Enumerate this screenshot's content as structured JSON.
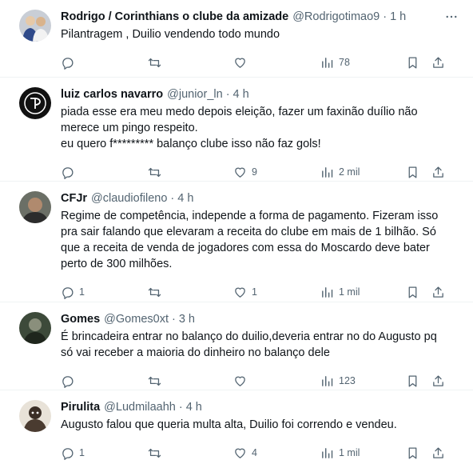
{
  "tweets": [
    {
      "name": "Rodrigo / Corinthians o clube da amizade",
      "handle": "@Rodrigotimao9",
      "sep": "·",
      "time": "1 h",
      "lines": [
        "Pilantragem , Duilio vendendo todo mundo"
      ],
      "replies": "",
      "retweets": "",
      "likes": "",
      "views": "78"
    },
    {
      "name": "luiz carlos navarro",
      "handle": "@junior_ln",
      "sep": "·",
      "time": "4 h",
      "lines": [
        "piada esse era meu medo depois eleição, fazer um faxinão duílio não merece um pingo respeito.",
        "eu quero f********* balanço clube isso não faz gols!"
      ],
      "replies": "",
      "retweets": "",
      "likes": "9",
      "views": "2 mil"
    },
    {
      "name": "CFJr",
      "handle": "@claudiofileno",
      "sep": "·",
      "time": "4 h",
      "lines": [
        "Regime de competência, independe a forma de pagamento. Fizeram isso pra sair falando que elevaram a receita do clube em mais de 1 bilhão. Só que a receita de venda de jogadores com essa do Moscardo deve bater perto de 300 milhões."
      ],
      "replies": "1",
      "retweets": "",
      "likes": "1",
      "views": "1 mil"
    },
    {
      "name": "Gomes",
      "handle": "@Gomes0xt",
      "sep": "·",
      "time": "3 h",
      "lines": [
        "É brincadeira entrar no balanço do duilio,deveria entrar no do Augusto pq só vai receber a maioria do dinheiro no balanço dele"
      ],
      "replies": "",
      "retweets": "",
      "likes": "",
      "views": "123"
    },
    {
      "name": "Pirulita",
      "handle": "@Ludmilaahh",
      "sep": "·",
      "time": "4 h",
      "lines": [
        "Augusto falou que queria multa alta, Duilio foi correndo e vendeu."
      ],
      "replies": "1",
      "retweets": "",
      "likes": "4",
      "views": "1 mil"
    }
  ],
  "icons": {
    "reply": "reply-icon",
    "retweet": "retweet-icon",
    "like": "heart-icon",
    "views": "views-icon",
    "bookmark": "bookmark-icon",
    "share": "share-icon",
    "more": "more-options-icon"
  },
  "colors": {
    "text": "#0f1419",
    "secondary": "#536471",
    "divider": "#eff3f4"
  }
}
